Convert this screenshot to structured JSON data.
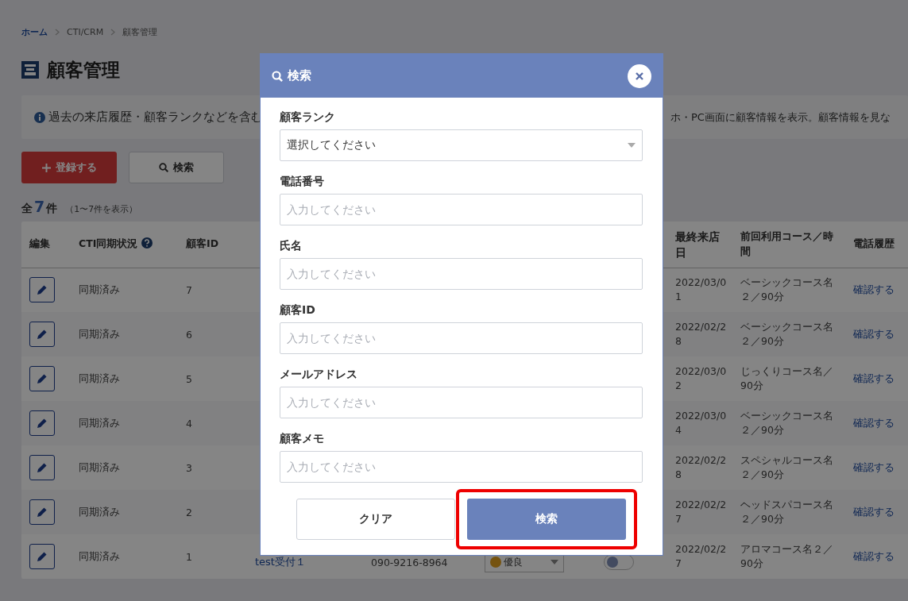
{
  "breadcrumb": [
    {
      "label": "ホーム",
      "link": true
    },
    {
      "label": "CTI/CRM",
      "link": false
    },
    {
      "label": "顧客管理",
      "link": false
    }
  ],
  "page_title": "顧客管理",
  "notice": {
    "text_left": "過去の来店履歴・顧客ランクなどを含む",
    "text_right": "ホ・PC画面に顧客情報を表示。顧客情報を見な"
  },
  "actions": [
    {
      "label": "登録する",
      "kind": "primary"
    },
    {
      "label": "検索",
      "kind": "search"
    }
  ],
  "count": {
    "prefix": "全",
    "number": "7",
    "suffix": "件",
    "range": "（1〜7件を表示）"
  },
  "table": {
    "columns": [
      {
        "label": "編集",
        "help": false
      },
      {
        "label": "CTI同期状況",
        "help": true
      },
      {
        "label": "顧客ID",
        "help": false
      },
      {
        "label": "最終来店日",
        "help": false
      },
      {
        "label": "前回利用コース／時間",
        "help": false
      },
      {
        "label": "電話履歴",
        "help": false
      }
    ],
    "rows": [
      {
        "sync": "同期済み",
        "id": "7",
        "last_visit": "2022/03/01",
        "course": "ベーシックコース名２／90分",
        "history": "確認する"
      },
      {
        "sync": "同期済み",
        "id": "6",
        "last_visit": "2022/02/28",
        "course": "ベーシックコース名２／90分",
        "history": "確認する"
      },
      {
        "sync": "同期済み",
        "id": "5",
        "last_visit": "2022/03/02",
        "course": "じっくりコース名／90分",
        "history": "確認する"
      },
      {
        "sync": "同期済み",
        "id": "4",
        "last_visit": "2022/03/04",
        "course": "ベーシックコース名２／90分",
        "history": "確認する"
      },
      {
        "sync": "同期済み",
        "id": "3",
        "last_visit": "2022/02/28",
        "course": "スペシャルコース名２／90分",
        "history": "確認する"
      },
      {
        "sync": "同期済み",
        "id": "2",
        "last_visit": "2022/02/27",
        "course": "ヘッドスパコース名２／90分",
        "history": "確認する"
      },
      {
        "sync": "同期済み",
        "id": "1",
        "name": "test受付１",
        "phone": "090-9216-8964",
        "rank": "優良",
        "cti_on": false,
        "last_visit": "2022/02/27",
        "course": "アロマコース名２／90分",
        "history": "確認する"
      }
    ]
  },
  "dialog": {
    "title": "検索",
    "fields": [
      {
        "label": "顧客ランク",
        "kind": "select",
        "placeholder": "選択してください"
      },
      {
        "label": "電話番号",
        "kind": "text",
        "placeholder": "入力してください"
      },
      {
        "label": "氏名",
        "kind": "text",
        "placeholder": "入力してください"
      },
      {
        "label": "顧客ID",
        "kind": "text",
        "placeholder": "入力してください"
      },
      {
        "label": "メールアドレス",
        "kind": "text",
        "placeholder": "入力してください"
      },
      {
        "label": "顧客メモ",
        "kind": "text",
        "placeholder": "入力してください"
      }
    ],
    "buttons": [
      {
        "label": "クリア",
        "kind": "clear",
        "highlighted": false
      },
      {
        "label": "検索",
        "kind": "submit",
        "highlighted": true
      }
    ]
  }
}
